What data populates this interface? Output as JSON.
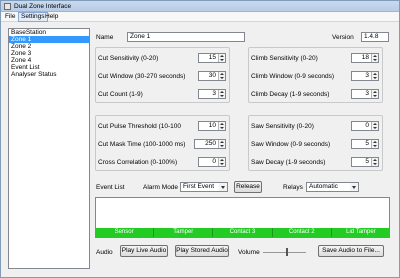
{
  "window": {
    "title": "Dual Zone Interface"
  },
  "menu": [
    "File",
    "Settings",
    "Help"
  ],
  "tree": {
    "items": [
      "BaseStation",
      "Zone 1",
      "Zone 2",
      "Zone 3",
      "Zone 4",
      "Event List",
      "Analyser Status"
    ],
    "selected": "Zone 1"
  },
  "header": {
    "name_label": "Name",
    "name_value": "Zone 1",
    "version_label": "Version",
    "version_value": "1.4.8"
  },
  "cut_group": [
    {
      "label": "Cut Sensitivity (0-20)",
      "value": "15"
    },
    {
      "label": "Cut Window (30-270 seconds)",
      "value": "30"
    },
    {
      "label": "Cut Count (1-9)",
      "value": "3"
    }
  ],
  "climb_group": [
    {
      "label": "Climb Sensitivity (0-20)",
      "value": "18"
    },
    {
      "label": "Climb Window (0-9 seconds)",
      "value": "3"
    },
    {
      "label": "Climb Decay (1-9 seconds)",
      "value": "3"
    }
  ],
  "pulse_group": [
    {
      "label": "Cut Pulse Threshold (10-100",
      "value": "10"
    },
    {
      "label": "Cut Mask Time (100-1000 ms)",
      "value": "250"
    },
    {
      "label": "Cross Correlation (0-100%)",
      "value": "0"
    }
  ],
  "saw_group": [
    {
      "label": "Saw Sensitivity (0-20)",
      "value": "0"
    },
    {
      "label": "Saw Window (0-9 seconds)",
      "value": "5"
    },
    {
      "label": "Saw Decay (1-9 seconds)",
      "value": "5"
    }
  ],
  "event_row": {
    "event_list_label": "Event List",
    "alarm_mode_label": "Alarm Mode",
    "alarm_mode_value": "First Event",
    "release_label": "Release",
    "relays_label": "Relays",
    "relays_value": "Automatic"
  },
  "status_bar": [
    "Sensor",
    "Tamper",
    "Contact 3",
    "Contact 2",
    "Lid Tamper"
  ],
  "audio_row": {
    "audio_label": "Audio",
    "play_live_label": "Play Live Audio",
    "play_stored_label": "Play Stored Audio",
    "volume_label": "Volume",
    "save_audio_label": "Save Audio to File..."
  },
  "volume_level": 0.55,
  "colors": {
    "status_green": "#22cc22",
    "selection_blue": "#3399ff"
  }
}
